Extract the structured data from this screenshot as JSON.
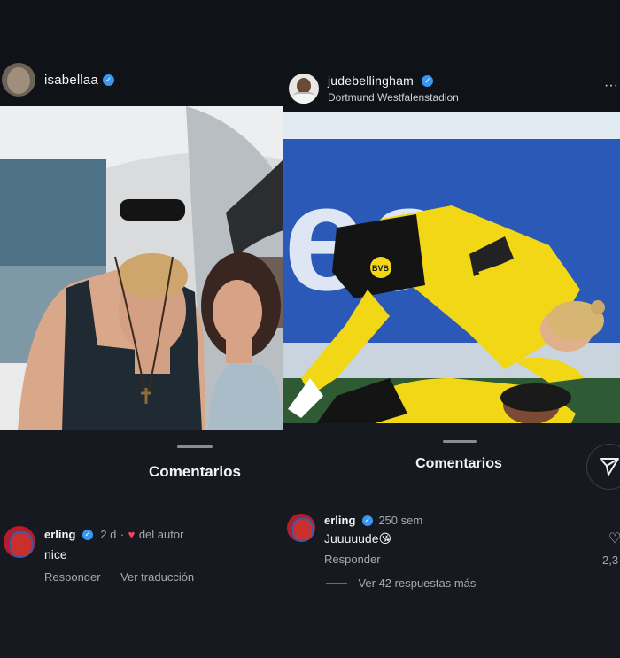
{
  "left": {
    "username": "isabellaa",
    "comments_title": "Comentarios",
    "comment": {
      "user": "erling",
      "age": "2 d",
      "dot": "·",
      "liked_label": "del autor",
      "text": "nice",
      "reply": "Responder",
      "translate": "Ver traducción"
    }
  },
  "right": {
    "username": "judebellingham",
    "location": "Dortmund Westfalenstadion",
    "more": "···",
    "comments_title": "Comentarios",
    "comment": {
      "user": "erling",
      "age": "250 sem",
      "text": "Juuuuude😘",
      "reply": "Responder",
      "likes": "2,3",
      "view_replies": "Ver 42 respuestas más"
    },
    "photo_text": {
      "billboard": "ea",
      "jersey": "BVB"
    }
  },
  "colors": {
    "verified": "#3897f0",
    "heart": "#ed4956",
    "bvb_yellow": "#f2d716"
  }
}
